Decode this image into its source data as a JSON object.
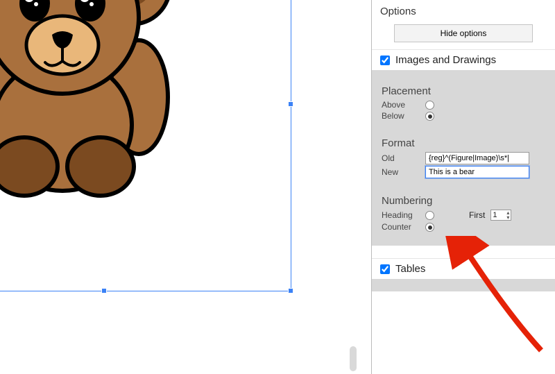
{
  "options": {
    "title": "Options",
    "hide_label": "Hide options"
  },
  "sections": {
    "images": {
      "enabled": true,
      "label": "Images and Drawings",
      "placement": {
        "title": "Placement",
        "above_label": "Above",
        "below_label": "Below",
        "selected": "below"
      },
      "format": {
        "title": "Format",
        "old_label": "Old",
        "new_label": "New",
        "old_value": "{reg}^(Figure|Image)\\s*|",
        "new_value": "This is a bear"
      },
      "numbering": {
        "title": "Numbering",
        "heading_label": "Heading",
        "counter_label": "Counter",
        "first_label": "First",
        "first_value": "1",
        "selected": "counter"
      }
    },
    "tables": {
      "enabled": true,
      "label": "Tables"
    }
  },
  "canvas": {
    "image_alt": "teddy-bear-illustration"
  }
}
